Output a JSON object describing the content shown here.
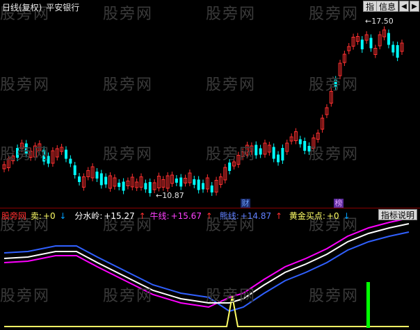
{
  "header": {
    "chart_title": "日线(复权)",
    "stock_name": "平安银行",
    "btn_index": "指",
    "btn_info": "信息",
    "btn_prev": "◀",
    "btn_next": "▶"
  },
  "watermark": "股旁网",
  "price_high_label": "17.50",
  "price_low_label": "10.87",
  "markers": {
    "cai": "财",
    "bang": "榜"
  },
  "indicator": {
    "name": "股旁网",
    "sell_label": "卖:",
    "sell_value": "+0",
    "fsl_label": "分水岭:",
    "fsl_value": "+15.27",
    "niu_label": "牛线:",
    "niu_value": "+15.67",
    "xiong_label": "熊线:",
    "xiong_value": "+14.87",
    "gold_label": "黄金买点:",
    "gold_value": "+0",
    "help_button": "指标说明"
  },
  "colors": {
    "up_candle": "#ff3030",
    "down_candle": "#00ffff",
    "niu_line": "#ff00ff",
    "xiong_line": "#3060ff",
    "fsl_line": "#ffffff",
    "gold_line": "#ffff66",
    "buy_bar": "#00ff00",
    "divider": "#8b0000"
  }
}
